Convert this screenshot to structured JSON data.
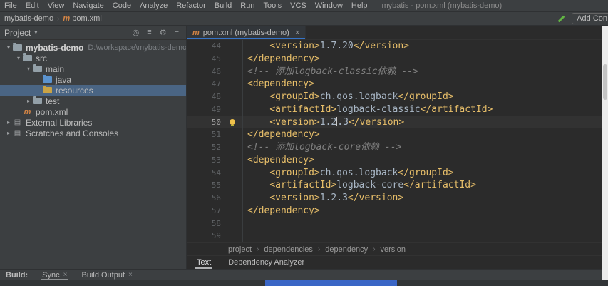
{
  "theme": {
    "panel_bg": "#3c3f41",
    "editor_bg": "#2b2b2b",
    "tag_color": "#e8bf6a",
    "text_color": "#a9b7c6",
    "comment_color": "#808080",
    "selection_color": "#4a6584",
    "tab_underline": "#3674c8"
  },
  "menu_bar": {
    "items": [
      "File",
      "Edit",
      "View",
      "Navigate",
      "Code",
      "Analyze",
      "Refactor",
      "Build",
      "Run",
      "Tools",
      "VCS",
      "Window",
      "Help"
    ],
    "window_title": "mybatis - pom.xml (mybatis-demo)"
  },
  "toolbar": {
    "breadcrumb": [
      {
        "label": "mybatis-demo",
        "icon": "none"
      },
      {
        "label": "pom.xml",
        "icon": "maven"
      }
    ],
    "add_configuration_label": "Add Con"
  },
  "project_panel": {
    "title": "Project",
    "header_icons": [
      "locate-icon",
      "collapse-all-icon",
      "settings-gear-icon",
      "hide-panel-icon"
    ],
    "tree": [
      {
        "label": "mybatis-demo",
        "detail": "D:\\workspace\\mybatis-demo",
        "level": 0,
        "icon": "folder",
        "arrow": "expanded",
        "bold": true
      },
      {
        "label": "src",
        "level": 1,
        "icon": "folder",
        "arrow": "expanded"
      },
      {
        "label": "main",
        "level": 2,
        "icon": "folder",
        "arrow": "expanded"
      },
      {
        "label": "java",
        "level": 3,
        "icon": "folder-java",
        "arrow": "none"
      },
      {
        "label": "resources",
        "level": 3,
        "icon": "folder-resources",
        "arrow": "none",
        "selected": true
      },
      {
        "label": "test",
        "level": 2,
        "icon": "folder",
        "arrow": "collapsed"
      },
      {
        "label": "pom.xml",
        "level": 1,
        "icon": "maven",
        "arrow": "none"
      },
      {
        "label": "External Libraries",
        "level": 0,
        "icon": "libraries",
        "arrow": "collapsed"
      },
      {
        "label": "Scratches and Consoles",
        "level": 0,
        "icon": "scratches",
        "arrow": "collapsed"
      }
    ]
  },
  "editor": {
    "tab": {
      "label": "pom.xml (mybatis-demo)",
      "icon": "maven",
      "close": "×"
    },
    "lines": [
      {
        "num": 44,
        "indent": 4,
        "segments": [
          {
            "type": "tag",
            "text": "<version>"
          },
          {
            "type": "text",
            "text": "1.7.20"
          },
          {
            "type": "tag",
            "text": "</version>"
          }
        ]
      },
      {
        "num": 45,
        "indent": 0,
        "segments": [
          {
            "type": "tag",
            "text": "</dependency>"
          }
        ]
      },
      {
        "num": 46,
        "indent": 0,
        "segments": [
          {
            "type": "comment",
            "text": "<!-- 添加logback-classic依赖 -->"
          }
        ]
      },
      {
        "num": 47,
        "indent": 0,
        "segments": [
          {
            "type": "tag",
            "text": "<dependency>"
          }
        ]
      },
      {
        "num": 48,
        "indent": 4,
        "segments": [
          {
            "type": "tag",
            "text": "<groupId>"
          },
          {
            "type": "text",
            "text": "ch.qos.logback"
          },
          {
            "type": "tag",
            "text": "</groupId>"
          }
        ]
      },
      {
        "num": 49,
        "indent": 4,
        "segments": [
          {
            "type": "tag",
            "text": "<artifactId>"
          },
          {
            "type": "text",
            "text": "logback-classic"
          },
          {
            "type": "tag",
            "text": "</artifactId>"
          }
        ]
      },
      {
        "num": 50,
        "indent": 4,
        "current": true,
        "bulb": true,
        "segments": [
          {
            "type": "tag",
            "text": "<version>"
          },
          {
            "type": "text",
            "text": "1.2"
          },
          {
            "type": "caret"
          },
          {
            "type": "text",
            "text": ".3"
          },
          {
            "type": "tag",
            "text": "</version>"
          }
        ]
      },
      {
        "num": 51,
        "indent": 0,
        "segments": [
          {
            "type": "tag",
            "text": "</dependency>"
          }
        ]
      },
      {
        "num": 52,
        "indent": 0,
        "segments": [
          {
            "type": "comment",
            "text": "<!-- 添加logback-core依赖 -->"
          }
        ]
      },
      {
        "num": 53,
        "indent": 0,
        "segments": [
          {
            "type": "tag",
            "text": "<dependency>"
          }
        ]
      },
      {
        "num": 54,
        "indent": 4,
        "segments": [
          {
            "type": "tag",
            "text": "<groupId>"
          },
          {
            "type": "text",
            "text": "ch.qos.logback"
          },
          {
            "type": "tag",
            "text": "</groupId>"
          }
        ]
      },
      {
        "num": 55,
        "indent": 4,
        "segments": [
          {
            "type": "tag",
            "text": "<artifactId>"
          },
          {
            "type": "text",
            "text": "logback-core"
          },
          {
            "type": "tag",
            "text": "</artifactId>"
          }
        ]
      },
      {
        "num": 56,
        "indent": 4,
        "segments": [
          {
            "type": "tag",
            "text": "<version>"
          },
          {
            "type": "text",
            "text": "1.2.3"
          },
          {
            "type": "tag",
            "text": "</version>"
          }
        ]
      },
      {
        "num": 57,
        "indent": 0,
        "segments": [
          {
            "type": "tag",
            "text": "</dependency>"
          }
        ]
      },
      {
        "num": 58,
        "indent": 0,
        "segments": []
      },
      {
        "num": 59,
        "indent": 0,
        "segments": []
      }
    ],
    "breadcrumbs": [
      "project",
      "dependencies",
      "dependency",
      "version"
    ],
    "view_tabs": [
      {
        "label": "Text",
        "active": true
      },
      {
        "label": "Dependency Analyzer",
        "active": false
      }
    ]
  },
  "build_panel": {
    "label": "Build:",
    "tabs": [
      {
        "label": "Sync",
        "active": true,
        "close": "×"
      },
      {
        "label": "Build Output",
        "active": false,
        "close": "×"
      }
    ]
  }
}
